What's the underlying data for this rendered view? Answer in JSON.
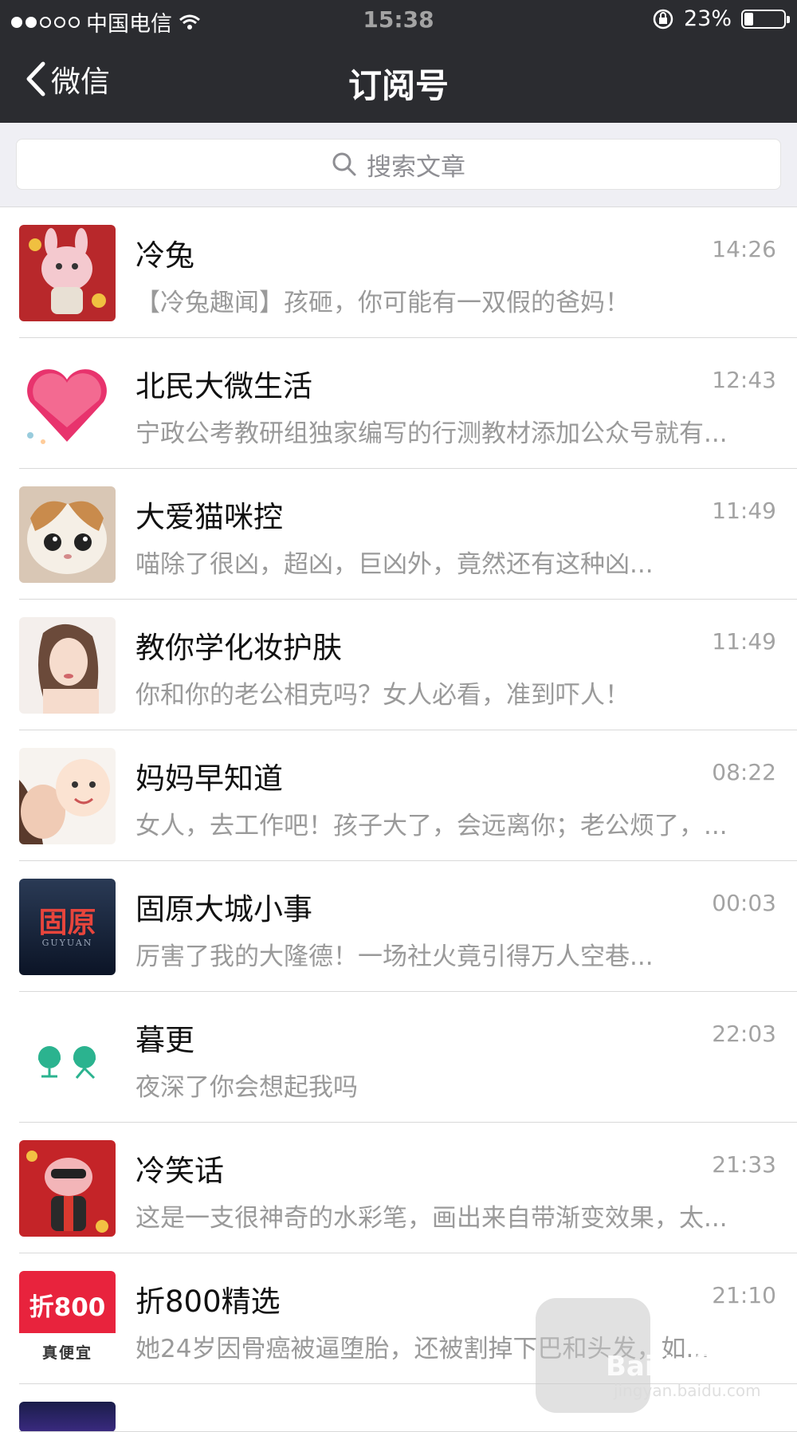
{
  "status_bar": {
    "carrier": "中国电信",
    "time": "15:38",
    "battery_text": "23%",
    "battery_level": 0.23
  },
  "nav": {
    "back_label": "微信",
    "title": "订阅号"
  },
  "search": {
    "placeholder": "搜索文章"
  },
  "items": [
    {
      "name": "冷兔",
      "time": "14:26",
      "preview": "【冷兔趣闻】孩砸，你可能有一双假的爸妈！"
    },
    {
      "name": "北民大微生活",
      "time": "12:43",
      "preview": "宁政公考教研组独家编写的行测教材添加公众号就有..."
    },
    {
      "name": "大爱猫咪控",
      "time": "11:49",
      "preview": "喵除了很凶，超凶，巨凶外，竟然还有这种凶..."
    },
    {
      "name": "教你学化妆护肤",
      "time": "11:49",
      "preview": "你和你的老公相克吗？女人必看，准到吓人！"
    },
    {
      "name": "妈妈早知道",
      "time": "08:22",
      "preview": "女人，去工作吧！孩子大了，会远离你；老公烦了，..."
    },
    {
      "name": "固原大城小事",
      "time": "00:03",
      "preview": "厉害了我的大隆德！一场社火竟引得万人空巷..."
    },
    {
      "name": "暮更",
      "time": "22:03",
      "preview": "夜深了你会想起我吗"
    },
    {
      "name": "冷笑话",
      "time": "21:33",
      "preview": "这是一支很神奇的水彩笔，画出来自带渐变效果，太..."
    },
    {
      "name": "折800精选",
      "time": "21:10",
      "preview": "她24岁因骨癌被逼堕胎，还被割掉下巴和头发，如..."
    }
  ],
  "avatar_text": {
    "guyuan_cn": "固原",
    "guyuan_en": "GUYUAN",
    "zhe800_top": "折800",
    "zhe800_bottom": "真便宜"
  },
  "watermark": {
    "brand": "Baidu经验",
    "url": "jingyan.baidu.com"
  }
}
